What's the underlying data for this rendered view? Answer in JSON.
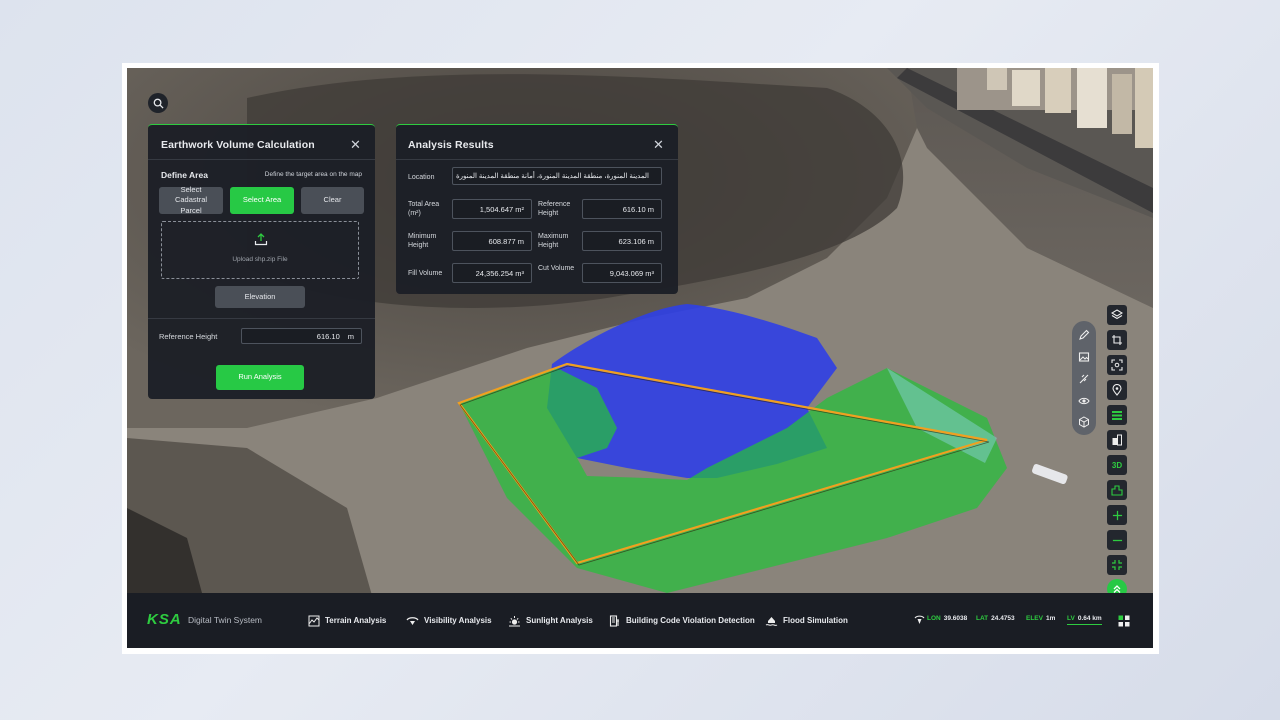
{
  "earthwork_panel": {
    "title": "Earthwork Volume Calculation",
    "define_area": "Define Area",
    "define_hint": "Define the target area on the map",
    "select_parcel": "Select Cadastral Parcel",
    "select_area": "Select Area",
    "clear": "Clear",
    "upload_text": "Upload shp.zip File",
    "elevation": "Elevation",
    "ref_height_label": "Reference Height",
    "ref_height_value": "616.10",
    "ref_height_unit": "m",
    "run": "Run Analysis"
  },
  "results_panel": {
    "title": "Analysis Results",
    "location_label": "Location",
    "location_value": "المدينة المنورة، منطقة المدينة المنورة، أمانة منطقة المدينة المنورة",
    "total_area_label": "Total Area (m²)",
    "total_area_value": "1,504.647 m²",
    "ref_height_label": "Reference Height",
    "ref_height_value": "616.10 m",
    "min_height_label": "Minimum Height",
    "min_height_value": "608.877 m",
    "max_height_label": "Maximum Height",
    "max_height_value": "623.106 m",
    "fill_label": "Fill Volume",
    "fill_value": "24,356.254 m³",
    "cut_label": "Cut Volume",
    "cut_value": "9,043.069 m³"
  },
  "map_tools": {
    "right_toolbar": [
      "layers-icon",
      "crop-icon",
      "target-frame-icon",
      "location-pin-icon",
      "list-icon",
      "building-icon",
      "3d-toggle",
      "buildings-icon",
      "zoom-in-icon",
      "zoom-out-icon",
      "fullscreen-icon",
      "collapse-up-icon"
    ],
    "three_d_label": "3D",
    "draw_toolbar": [
      "pencil-icon",
      "image-icon",
      "measure-icon",
      "eye-icon",
      "cube-icon"
    ]
  },
  "bottom_bar": {
    "logo": "KSA",
    "app_name": "Digital Twin System",
    "nav": [
      {
        "label": "Terrain Analysis",
        "icon": "terrain-icon"
      },
      {
        "label": "Visibility Analysis",
        "icon": "visibility-icon"
      },
      {
        "label": "Sunlight Analysis",
        "icon": "sun-icon"
      },
      {
        "label": "Building Code Violation Detection",
        "icon": "building-code-icon"
      },
      {
        "label": "Flood Simulation",
        "icon": "flood-icon"
      }
    ],
    "coords": {
      "lon_label": "LON",
      "lon_value": "39.6038",
      "lat_label": "LAT",
      "lat_value": "24.4753",
      "elev_label": "ELEV",
      "elev_value": "1m",
      "lv_label": "LV",
      "lv_value": "0.64 km"
    }
  },
  "colors": {
    "accent": "#27c945",
    "panel": "#1c1f26",
    "fill_overlay": "#2ecc40",
    "cut_overlay": "#2b3fe0",
    "boundary": "#f0a020"
  }
}
